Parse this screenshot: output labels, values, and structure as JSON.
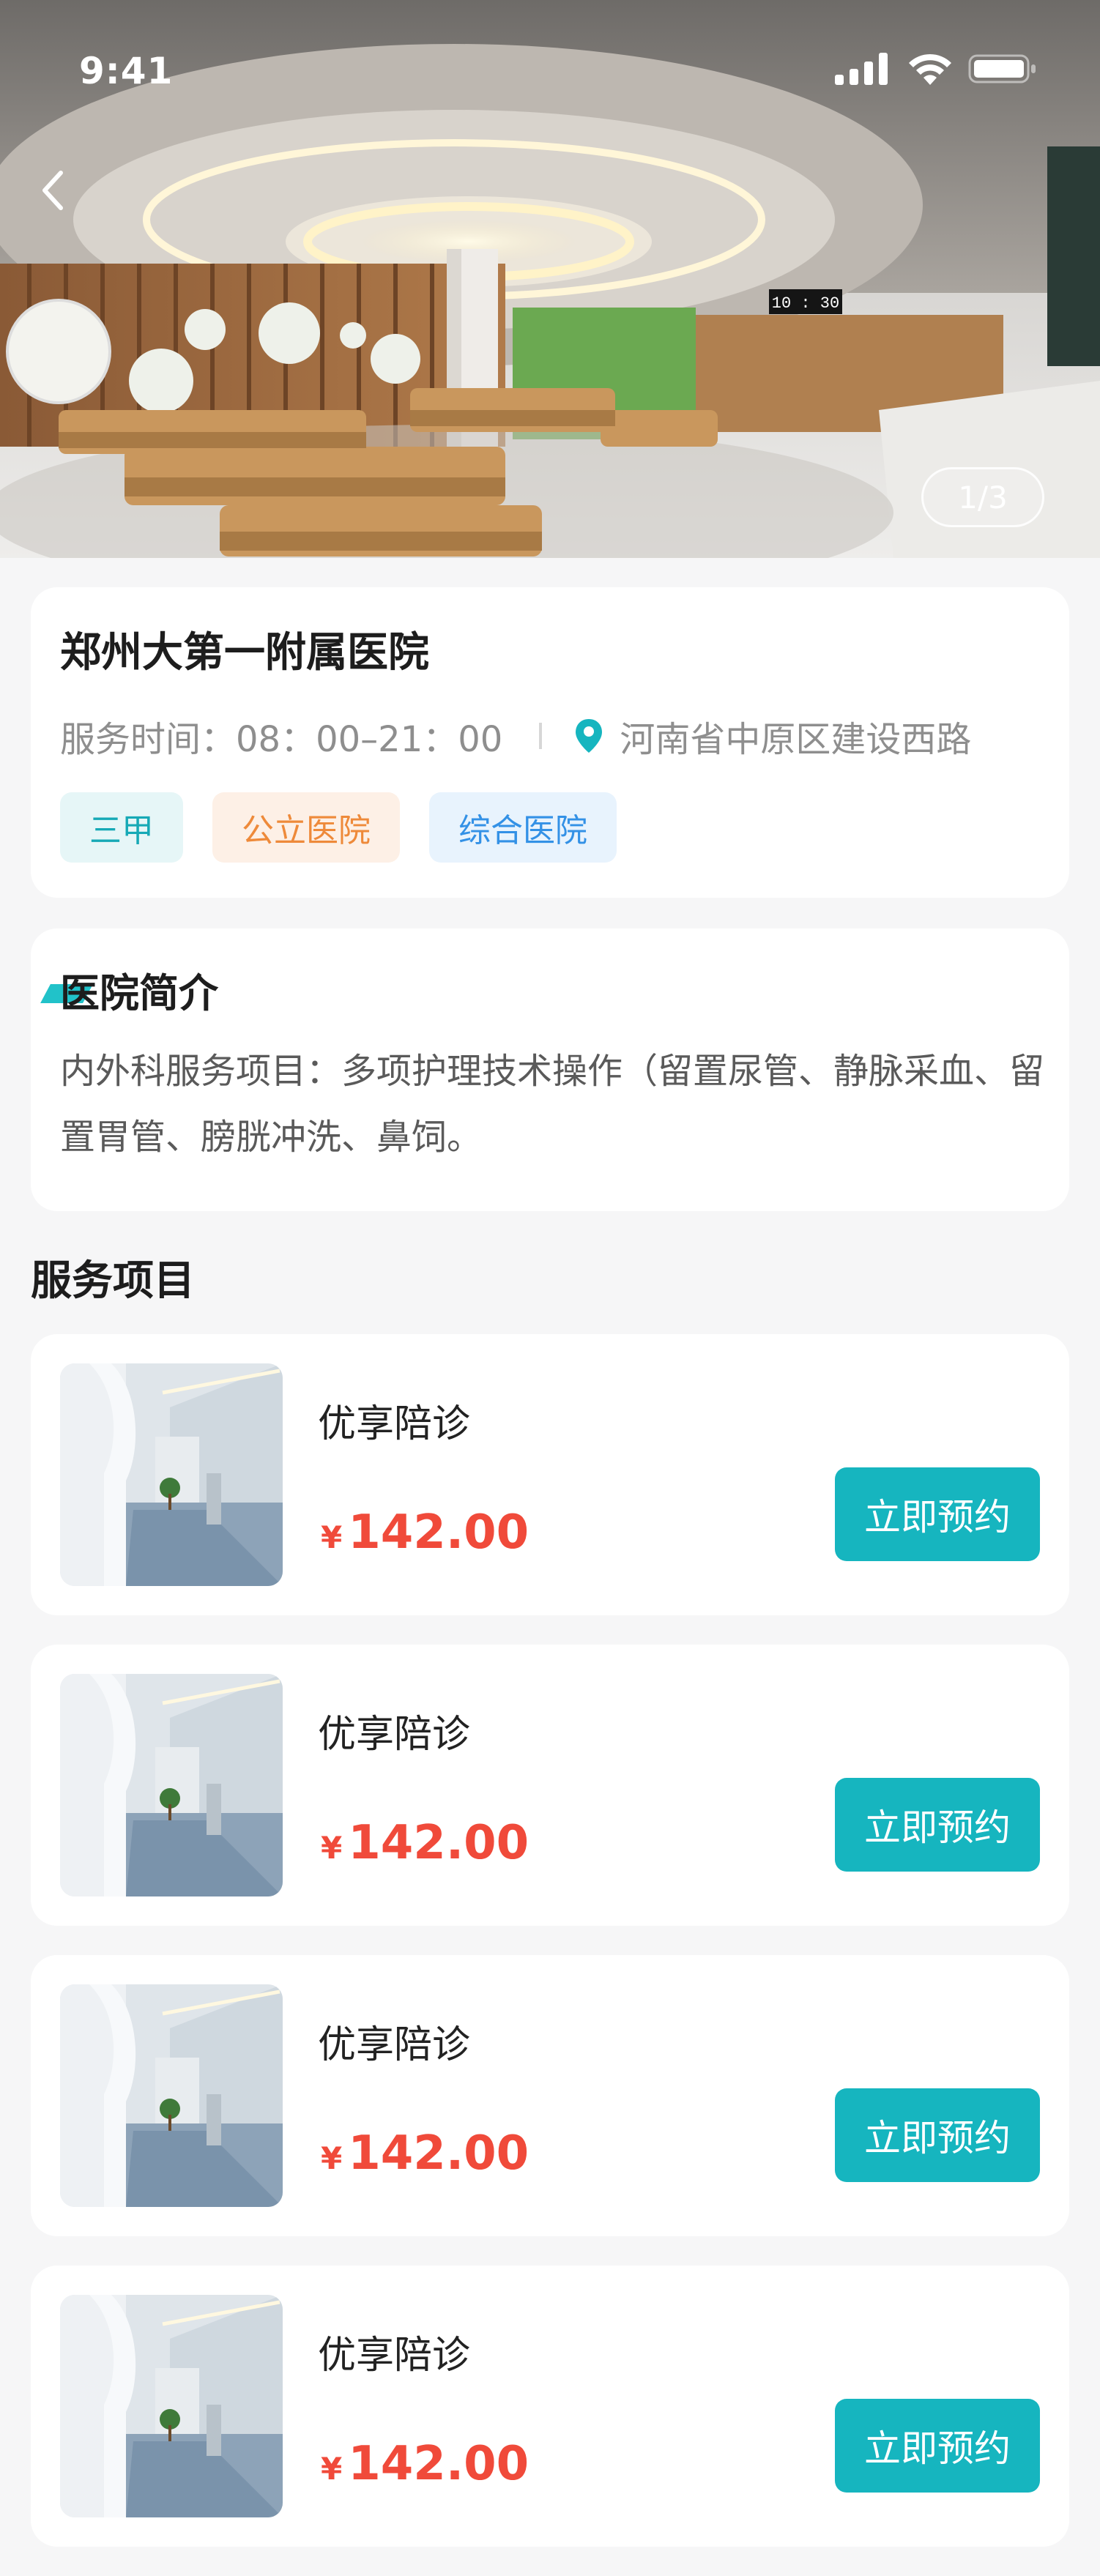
{
  "status_bar": {
    "time": "9:41"
  },
  "hero": {
    "clock_text": "10 : 30",
    "pager": "1/3"
  },
  "hospital": {
    "name": "郑州大第一附属医院",
    "hours_label": "服务时间：",
    "hours_value": "08：00–21：00",
    "address": "河南省中原区建设西路",
    "tags": [
      "三甲",
      "公立医院",
      "综合医院"
    ]
  },
  "intro": {
    "title": "医院简介",
    "text": "内外科服务项目：多项护理技术操作（留置尿管、静脉采血、留置胃管、膀胱冲洗、鼻饲。"
  },
  "services": {
    "title": "服务项目",
    "items": [
      {
        "name": "优享陪诊",
        "currency": "¥",
        "price": "142.00",
        "action": "立即预约"
      },
      {
        "name": "优享陪诊",
        "currency": "¥",
        "price": "142.00",
        "action": "立即预约"
      },
      {
        "name": "优享陪诊",
        "currency": "¥",
        "price": "142.00",
        "action": "立即预约"
      },
      {
        "name": "优享陪诊",
        "currency": "¥",
        "price": "142.00",
        "action": "立即预约"
      }
    ]
  },
  "colors": {
    "accent": "#16b5bf",
    "price": "#f04a3a",
    "tag_teal": "#16a9b6",
    "tag_orange": "#ee8a3a",
    "tag_blue": "#3391e6"
  },
  "icons": [
    "signal-icon",
    "wifi-icon",
    "battery-icon",
    "back-arrow-icon",
    "location-pin-icon"
  ]
}
